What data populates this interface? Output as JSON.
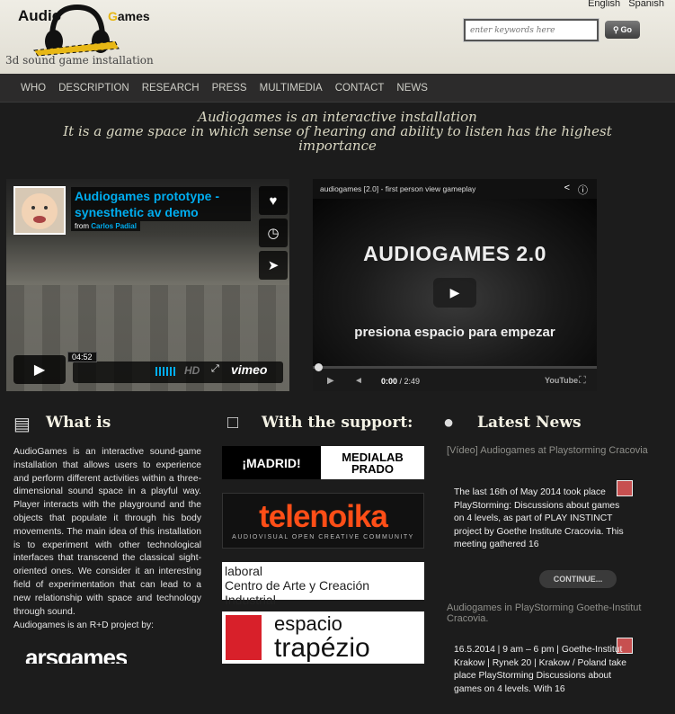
{
  "header": {
    "logo_audio": "Audio",
    "logo_games_g": "G",
    "logo_games_rest": "ames",
    "tagline": "3d sound game installation",
    "languages": [
      "English",
      "Spanish"
    ],
    "search_placeholder": "enter keywords here",
    "go_label": "Go"
  },
  "nav": [
    "WHO",
    "DESCRIPTION",
    "RESEARCH",
    "PRESS",
    "MULTIMEDIA",
    "CONTACT",
    "NEWS"
  ],
  "intro": {
    "line1": "Audiogames is an interactive installation",
    "line2": "It is a game space in which sense of hearing and ability to listen has the highest importance"
  },
  "video1": {
    "title": "Audiogames prototype - synesthetic av demo",
    "from_label": "from",
    "author": "Carlos Padial",
    "time": "04:52",
    "hd": "HD",
    "brand": "vimeo"
  },
  "video2": {
    "title": "audiogames [2.0] - first person view gameplay",
    "big_text": "AUDIOGAMES 2.0",
    "sub_text": "presiona espacio para empezar",
    "current": "0:00",
    "total": "/ 2:49",
    "youtube": "YouTube"
  },
  "what": {
    "title": "What is",
    "text": "AudioGames is an interactive sound-game installation that allows users to experience and perform different activities within a three-dimensional sound space in a playful way. Player interacts with the playground and the objects that populate it through his body movements. The main idea of this installation is to experiment with other technological interfaces that transcend the classical sight-oriented ones. We consider it an interesting field of experimentation that can lead to a new relationship with space and technology through sound.",
    "tail": "Audiogames is an R+D project by:",
    "logo": "arsgames"
  },
  "support": {
    "title": "With the support:",
    "madrid": "¡MADRID!",
    "medialab": "MEDIALAB PRADO",
    "telenoika": "telenoika",
    "telenoika_sub": "AUDIOVISUAL OPEN CREATIVE COMMUNITY",
    "laboral_a": "laboral",
    "laboral_b": "Centro de Arte y Creación Industrial",
    "trapezio_a": "espacio",
    "trapezio_b": "trapézio"
  },
  "news": {
    "title": "Latest News",
    "item1_link": "[Vídeo] Audiogames at Playstorming Cracovia",
    "item1_text": "The last 16th of May 2014 took place PlayStorming: Discussions about games on 4 levels, as part of PLAY INSTINCT project by Goethe Institute Cracovia. This meeting gathered 16",
    "continue": "CONTINUE...",
    "item2_link": "Audiogames in PlayStorming Goethe-Institut Cracovia.",
    "item2_text": "16.5.2014 | 9 am – 6 pm | Goethe-Institut Krakow | Rynek 20 | Krakow / Poland take place PlayStorming Discussions about games on 4 levels. With 16"
  },
  "colors": {
    "background": "#1c1c1c",
    "vimeo_blue": "#00adef",
    "telenoika_orange": "#ff4e17",
    "logo_yellow": "#e7b715"
  }
}
